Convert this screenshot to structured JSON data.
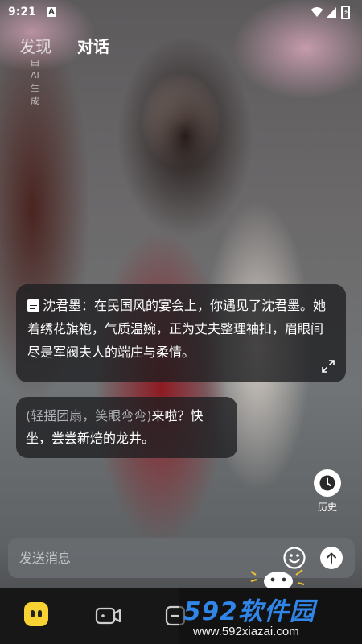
{
  "status_bar": {
    "time": "9:21",
    "notification_badge": "A",
    "icons": [
      "wifi-icon",
      "signal-icon",
      "battery-icon"
    ]
  },
  "header": {
    "tabs": [
      {
        "label": "发现",
        "active": false
      },
      {
        "label": "对话",
        "active": true
      }
    ],
    "discover_sublabel": "由AI生成"
  },
  "conversation": {
    "narration": "沈君墨：在民国风的宴会上，你遇见了沈君墨。她着绣花旗袍，气质温婉，正为丈夫整理袖扣，眉眼间尽是军阀夫人的端庄与柔情。",
    "reply_action": "(轻摇团扇，笑眼弯弯)",
    "reply_text": "来啦？快坐，尝尝新焙的龙井。"
  },
  "history_button": {
    "label": "历史",
    "icon": "clock-icon"
  },
  "composer": {
    "placeholder": "发送消息",
    "emoji_icon": "smiley-icon",
    "send_icon": "arrow-up-icon"
  },
  "bottom_nav": {
    "items": [
      {
        "icon": "home-mascot-icon"
      },
      {
        "icon": "video-icon"
      },
      {
        "icon": "create-icon"
      }
    ]
  },
  "watermark": {
    "logo_num": "592",
    "logo_text": "软件园",
    "url": "www.592xiazai.com"
  },
  "colors": {
    "bubble_bg": "#1e1e20",
    "nav_bg": "#171717",
    "accent_yellow": "#f7d232",
    "watermark_blue": "#2f86e8"
  }
}
